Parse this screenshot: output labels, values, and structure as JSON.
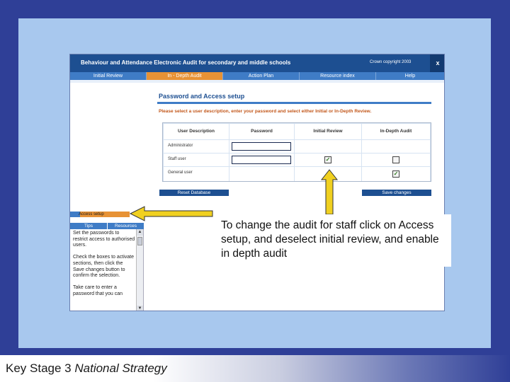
{
  "app": {
    "title": "Behaviour and Attendance Electronic Audit for secondary and middle schools",
    "copyright": "Crown copyright 2003",
    "close_label": "x"
  },
  "nav": [
    {
      "label": "Initial Review"
    },
    {
      "label": "In - Depth Audit"
    },
    {
      "label": "Action Plan"
    },
    {
      "label": "Resource index"
    },
    {
      "label": "Help"
    }
  ],
  "form": {
    "title": "Password and Access setup",
    "instruction": "Please select a user description, enter your password and select either Initial or In-Depth Review.",
    "headers": [
      "User Description",
      "Password",
      "Initial Review",
      "In-Depth Audit"
    ],
    "rows": [
      {
        "label": "Administrator",
        "initial_checked": false,
        "indepth_checked": false
      },
      {
        "label": "Staff user",
        "initial_checked": true,
        "indepth_checked": false
      },
      {
        "label": "General user",
        "initial_checked": false,
        "indepth_checked": true
      }
    ],
    "reset_label": "Reset Database",
    "save_label": "Save changes"
  },
  "panel": {
    "access_label": "Access setup",
    "tabs": [
      "Tips",
      "Resources"
    ],
    "text": "Set the passwords to restrict access to authorised users.\n\nCheck the boxes to activate sections, then click the Save changes button to confirm the selection.\n\nTake care to enter a password that you can"
  },
  "callout": {
    "text": "To change the audit for staff click on Access setup, and deselect initial review, and enable in depth audit"
  },
  "footer": {
    "bold_part": "Key Stage 3",
    "italic_part": "National Strategy"
  },
  "colors": {
    "arrow": "#f0d020",
    "nav_active": "#e79235",
    "header_bar": "#1d4f91"
  }
}
